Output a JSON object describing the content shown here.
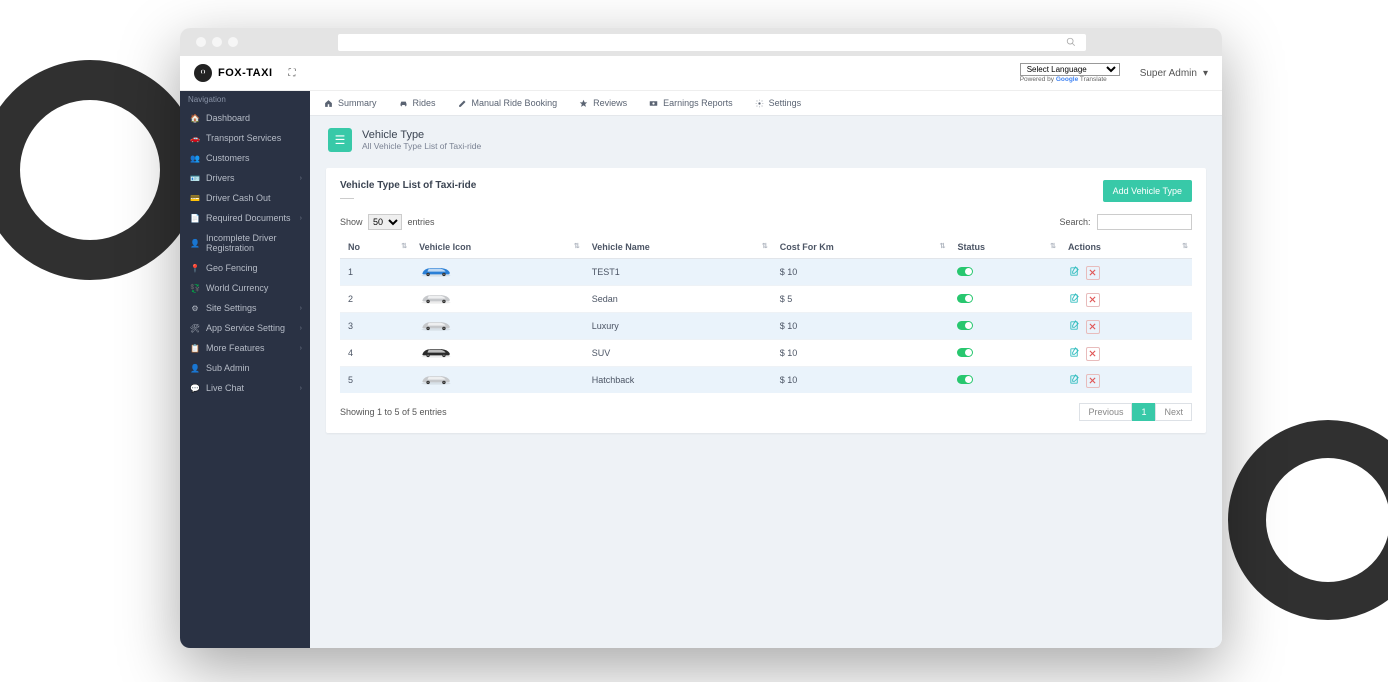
{
  "brand": {
    "name": "FOX-TAXI"
  },
  "lang": {
    "placeholder": "Select Language",
    "powered": "Powered by ",
    "google": "Google",
    "translate": " Translate"
  },
  "user": {
    "name": "Super Admin"
  },
  "sidebar": {
    "header": "Navigation",
    "items": [
      {
        "label": "Dashboard",
        "icon": "🏠",
        "expandable": false
      },
      {
        "label": "Transport Services",
        "icon": "🚗",
        "expandable": false
      },
      {
        "label": "Customers",
        "icon": "👥",
        "expandable": false
      },
      {
        "label": "Drivers",
        "icon": "🪪",
        "expandable": true
      },
      {
        "label": "Driver Cash Out",
        "icon": "💳",
        "expandable": false
      },
      {
        "label": "Required Documents",
        "icon": "📄",
        "expandable": true
      },
      {
        "label": "Incomplete Driver Registration",
        "icon": "👤",
        "expandable": false
      },
      {
        "label": "Geo Fencing",
        "icon": "📍",
        "expandable": false
      },
      {
        "label": "World Currency",
        "icon": "💱",
        "expandable": false
      },
      {
        "label": "Site Settings",
        "icon": "⚙",
        "expandable": true
      },
      {
        "label": "App Service Setting",
        "icon": "🛠",
        "expandable": true
      },
      {
        "label": "More Features",
        "icon": "📋",
        "expandable": true
      },
      {
        "label": "Sub Admin",
        "icon": "👤",
        "expandable": false
      },
      {
        "label": "Live Chat",
        "icon": "💬",
        "expandable": true
      }
    ]
  },
  "tabs": [
    {
      "label": "Summary",
      "icon": "home"
    },
    {
      "label": "Rides",
      "icon": "car"
    },
    {
      "label": "Manual Ride Booking",
      "icon": "edit"
    },
    {
      "label": "Reviews",
      "icon": "star"
    },
    {
      "label": "Earnings Reports",
      "icon": "money"
    },
    {
      "label": "Settings",
      "icon": "gear"
    }
  ],
  "page": {
    "title": "Vehicle Type",
    "subtitle": "All Vehicle Type List of Taxi-ride"
  },
  "panel": {
    "title": "Vehicle Type List of Taxi-ride",
    "add_button": "Add Vehicle Type"
  },
  "table": {
    "show_label_pre": "Show",
    "show_label_post": "entries",
    "show_value": "50",
    "search_label": "Search:",
    "columns": [
      "No",
      "Vehicle Icon",
      "Vehicle Name",
      "Cost For Km",
      "Status",
      "Actions"
    ],
    "rows": [
      {
        "no": "1",
        "name": "TEST1",
        "cost": "$ 10",
        "color": "#2a7fd6"
      },
      {
        "no": "2",
        "name": "Sedan",
        "cost": "$ 5",
        "color": "#c6c8cb"
      },
      {
        "no": "3",
        "name": "Luxury",
        "cost": "$ 10",
        "color": "#c6c8cb"
      },
      {
        "no": "4",
        "name": "SUV",
        "cost": "$ 10",
        "color": "#2b2b2b"
      },
      {
        "no": "5",
        "name": "Hatchback",
        "cost": "$ 10",
        "color": "#c6c8cb"
      }
    ],
    "footer": "Showing 1 to 5 of 5 entries",
    "prev": "Previous",
    "page1": "1",
    "next": "Next"
  }
}
